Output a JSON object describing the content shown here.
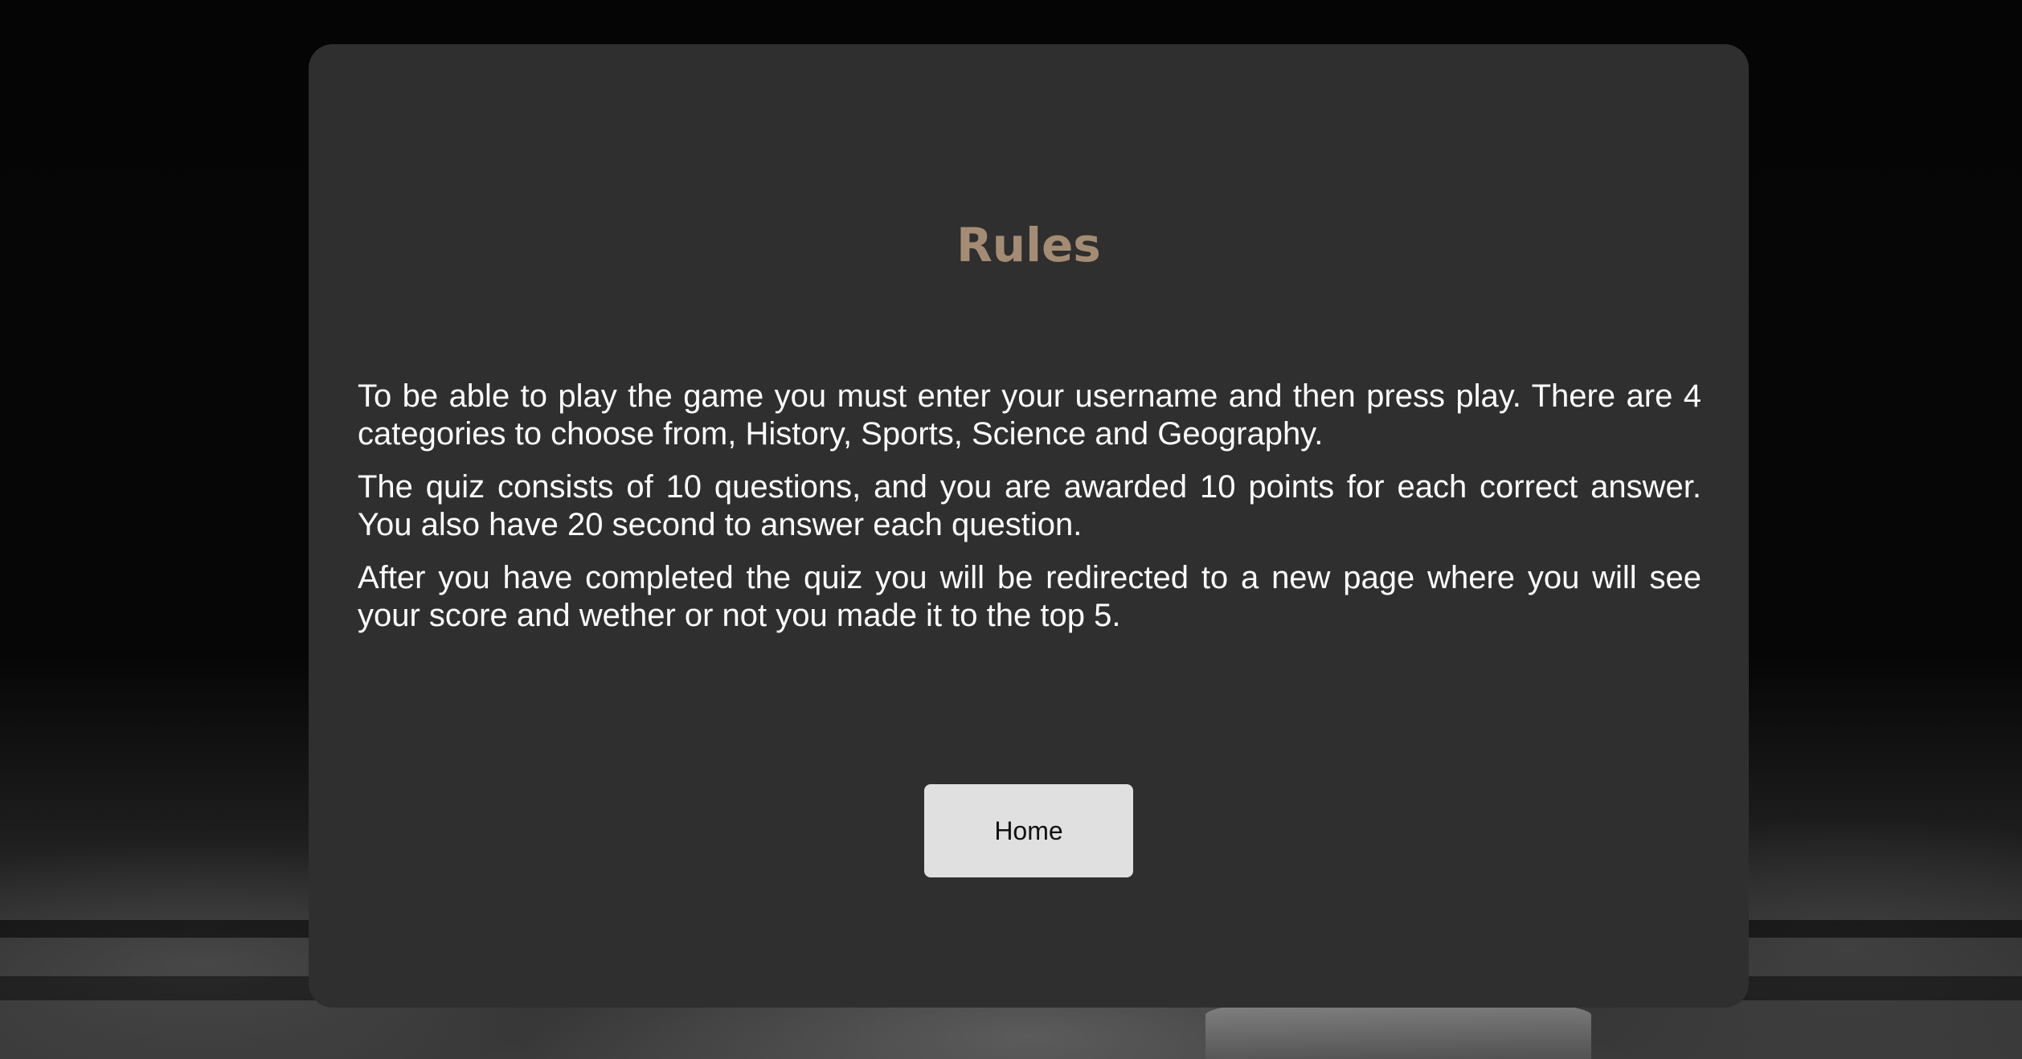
{
  "rules_page": {
    "title": "Rules",
    "paragraphs": [
      "To be able to play the game you must enter your username and then press play. There are 4 categories to choose from, History, Sports, Science and Geography.",
      "The quiz consists of 10 questions, and you are awarded 10 points for each correct answer. You also have 20 second to answer each question.",
      "After you have completed the quiz you will be redirected to a new page where you will see your score and wether or not you made it to the top 5."
    ],
    "home_button_label": "Home"
  },
  "colors": {
    "page_background": "#050505",
    "card_background": "#2f2f2f",
    "title": "#a48c74",
    "body_text": "#ffffff",
    "button_background": "#e0e0e0",
    "button_text": "#111111"
  }
}
